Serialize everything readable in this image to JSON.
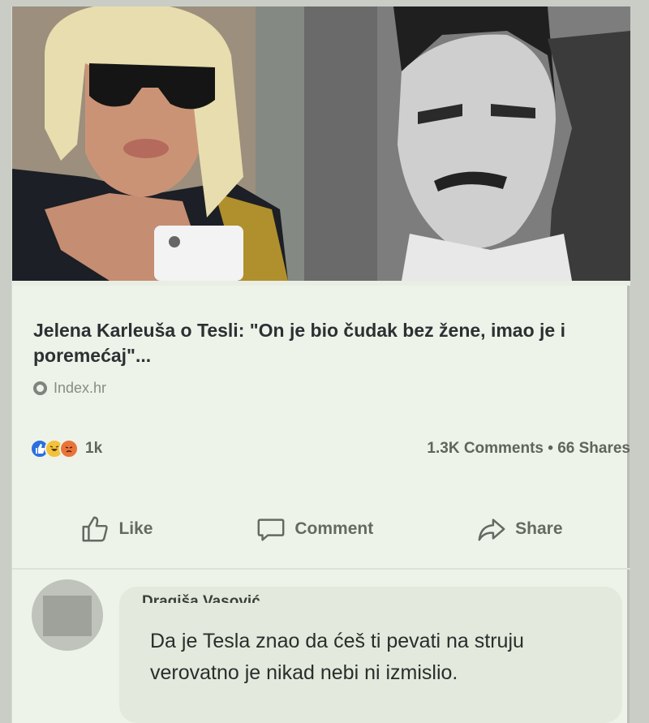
{
  "post": {
    "headline": "Jelena Karleuša o Tesli: \"On je bio čudak bez žene, imao je i poremećaj\"...",
    "source": "Index.hr",
    "reactions": {
      "icons": [
        "like-reaction-icon",
        "haha-reaction-icon",
        "angry-reaction-icon"
      ],
      "count": "1k"
    },
    "stats": "1.3K Comments • 66 Shares"
  },
  "actions": {
    "like": "Like",
    "comment": "Comment",
    "share": "Share"
  },
  "comment": {
    "author": "Dragiša Vasović",
    "text": "Da je Tesla znao da ćeš ti pevati na struju verovatno je nikad nebi ni izmislio."
  },
  "colors": {
    "card_bg": "#eef3e9",
    "like_blue": "#2b6fe0",
    "text_dark": "#2d3033",
    "text_muted": "#646a62"
  }
}
